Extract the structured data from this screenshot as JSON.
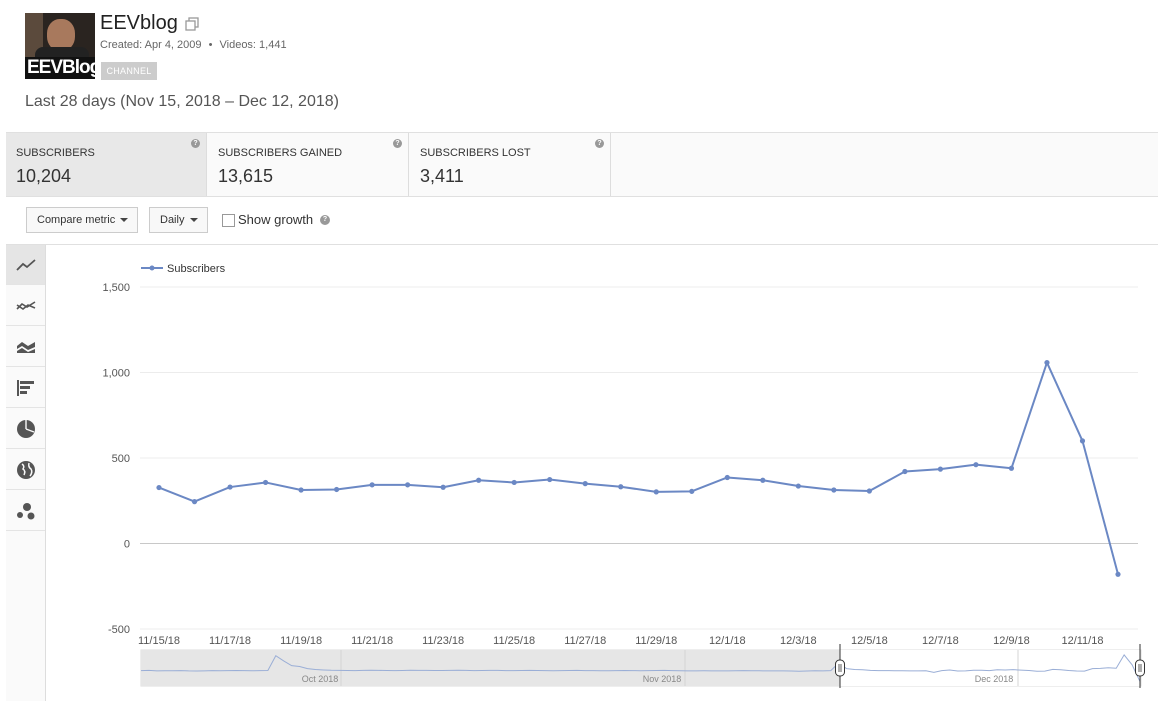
{
  "channel": {
    "name": "EEVblog",
    "created": "Created: Apr 4, 2009",
    "separator": "•",
    "videos": "Videos: 1,441",
    "badge": "CHANNEL",
    "thumb_text_1": "EEV",
    "thumb_text_2": "Blog"
  },
  "date_range": "Last 28 days (Nov 15, 2018 – Dec 12, 2018)",
  "metrics": [
    {
      "label": "SUBSCRIBERS",
      "value": "10,204",
      "active": true
    },
    {
      "label": "SUBSCRIBERS GAINED",
      "value": "13,615",
      "active": false
    },
    {
      "label": "SUBSCRIBERS LOST",
      "value": "3,411",
      "active": false
    }
  ],
  "controls": {
    "compare_metric": "Compare metric",
    "granularity": "Daily",
    "show_growth": "Show growth",
    "help_glyph": "?"
  },
  "view_buttons": [
    {
      "icon": "line-chart-icon",
      "active": true
    },
    {
      "icon": "multi-line-chart-icon",
      "active": false
    },
    {
      "icon": "stacked-area-chart-icon",
      "active": false
    },
    {
      "icon": "bar-chart-icon",
      "active": false
    },
    {
      "icon": "pie-chart-icon",
      "active": false
    },
    {
      "icon": "globe-map-icon",
      "active": false
    },
    {
      "icon": "bubble-chart-icon",
      "active": false
    }
  ],
  "chart_data": {
    "type": "line",
    "legend": "Subscribers",
    "legend_position": "top-left",
    "color": "#6b88c4",
    "grid": true,
    "ylim": [
      -500,
      1500
    ],
    "y_ticks": [
      1500,
      1000,
      500,
      0,
      -500
    ],
    "y_tick_labels": [
      "1,500",
      "1,000",
      "500",
      "0",
      "-500"
    ],
    "x": [
      "11/15/18",
      "11/16/18",
      "11/17/18",
      "11/18/18",
      "11/19/18",
      "11/20/18",
      "11/21/18",
      "11/22/18",
      "11/23/18",
      "11/24/18",
      "11/25/18",
      "11/26/18",
      "11/27/18",
      "11/28/18",
      "11/29/18",
      "11/30/18",
      "12/1/18",
      "12/2/18",
      "12/3/18",
      "12/4/18",
      "12/5/18",
      "12/6/18",
      "12/7/18",
      "12/8/18",
      "12/9/18",
      "12/10/18",
      "12/11/18",
      "12/12/18"
    ],
    "x_tick_labels": [
      "11/15/18",
      "11/17/18",
      "11/19/18",
      "11/21/18",
      "11/23/18",
      "11/25/18",
      "11/27/18",
      "11/29/18",
      "12/1/18",
      "12/3/18",
      "12/5/18",
      "12/7/18",
      "12/9/18",
      "12/11/18"
    ],
    "values": [
      327,
      245,
      330,
      357,
      313,
      316,
      343,
      343,
      329,
      370,
      357,
      374,
      350,
      332,
      302,
      305,
      386,
      370,
      336,
      313,
      307,
      421,
      435,
      461,
      440,
      1058,
      600,
      -180
    ],
    "navigator": {
      "labels": [
        "Oct 2018",
        "Nov 2018",
        "Dec 2018"
      ],
      "values": [
        328,
        340,
        318,
        325,
        322,
        330,
        315,
        312,
        318,
        330,
        320,
        328,
        335,
        326,
        322,
        328,
        335,
        1020,
        780,
        560,
        520,
        420,
        380,
        360,
        345,
        340,
        335,
        330,
        338,
        345,
        340,
        332,
        328,
        335,
        345,
        340,
        338,
        332,
        336,
        340,
        345,
        338,
        330,
        335,
        340,
        338,
        330,
        328,
        332,
        340,
        336,
        330,
        325,
        328,
        335,
        338,
        330,
        326,
        325,
        320,
        330,
        335,
        328,
        322,
        330,
        335,
        340,
        330,
        322,
        318,
        315,
        320,
        318,
        316,
        315,
        322,
        330,
        325,
        320,
        318,
        316,
        314,
        312,
        300,
        312,
        320,
        318,
        330,
        680,
        420,
        380,
        370,
        338,
        330,
        328,
        325,
        320,
        318,
        315,
        320,
        245,
        330,
        357,
        313,
        316,
        343,
        343,
        329,
        370,
        357,
        374,
        350,
        332,
        302,
        305,
        386,
        370,
        336,
        313,
        307,
        421,
        435,
        461,
        440,
        1058,
        600,
        -180
      ]
    }
  }
}
